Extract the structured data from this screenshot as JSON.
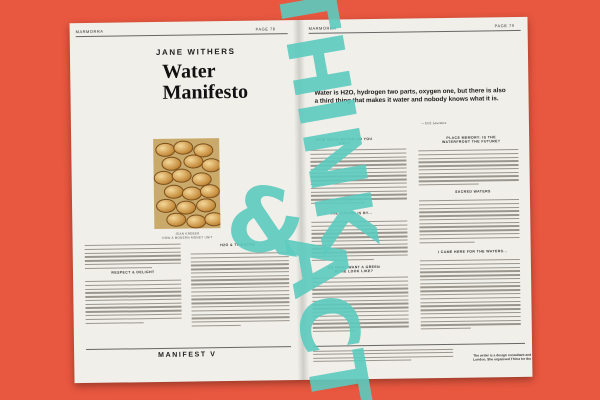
{
  "spread": {
    "left_folio_left": "MARMORRA",
    "left_folio_right": "PAGE 78",
    "right_folio_left": "MARMORRA",
    "right_folio_right": "PAGE 79"
  },
  "article": {
    "author": "JANE WITHERS",
    "title_line1": "Water",
    "title_line2": "Manifesto",
    "caption_line1": "JEAN KREBER",
    "caption_line2": "HOW A MODERN MONEY UNIT",
    "footer": "MANIFEST V",
    "pull_quote": "Water is H2O, hydrogen two parts, oxygen one, but there is also a third thing that makes it water and nobody knows what it is.",
    "pull_quote_credit": "— D.H. Lawrence",
    "author_bio": "The writer is a design consultant and curator based in London. She organised Thirst for the Stream in 2016"
  },
  "subheads": {
    "left_col1": "RESPECT & DELIGHT",
    "left_col2": "H2O & THIRSTER",
    "mid_col1": "HOW MUCH WATER DO YOU EAT?",
    "mid_col2": "THE FUTURE IS BY...",
    "mid_col3": "SO WHAT WANT A GREEN HOME LOOK LIKE?",
    "right_col1": "PLACE MEMORY: IS THE WATERFRONT THE FUTURE?",
    "right_col2": "SACRED WATERS",
    "right_col3": "I CAME HERE FOR THE WATERS..."
  },
  "overlay": {
    "word1": "THINK",
    "word2": "&",
    "word3": "ACT",
    "paint_color": "#5ccbbf"
  }
}
